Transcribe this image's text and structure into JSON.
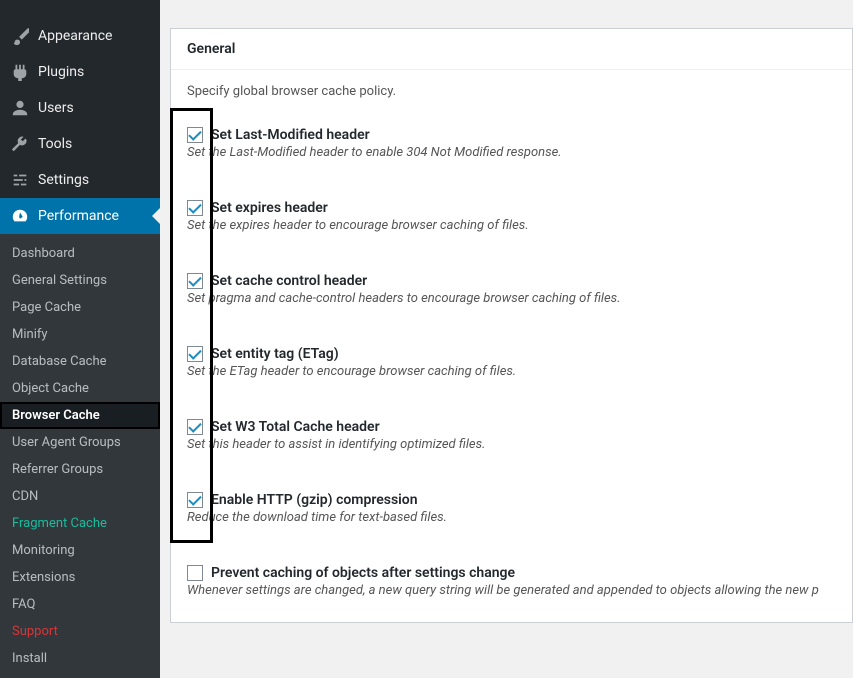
{
  "sidebar": {
    "main": [
      {
        "label": "Appearance",
        "icon": "brush"
      },
      {
        "label": "Plugins",
        "icon": "plug"
      },
      {
        "label": "Users",
        "icon": "user"
      },
      {
        "label": "Tools",
        "icon": "wrench"
      },
      {
        "label": "Settings",
        "icon": "sliders"
      },
      {
        "label": "Performance",
        "icon": "gauge",
        "active": true
      }
    ],
    "sub": [
      {
        "label": "Dashboard"
      },
      {
        "label": "General Settings"
      },
      {
        "label": "Page Cache"
      },
      {
        "label": "Minify"
      },
      {
        "label": "Database Cache"
      },
      {
        "label": "Object Cache"
      },
      {
        "label": "Browser Cache",
        "current": true
      },
      {
        "label": "User Agent Groups"
      },
      {
        "label": "Referrer Groups"
      },
      {
        "label": "CDN"
      },
      {
        "label": "Fragment Cache",
        "teal": true
      },
      {
        "label": "Monitoring"
      },
      {
        "label": "Extensions"
      },
      {
        "label": "FAQ"
      },
      {
        "label": "Support",
        "red": true
      },
      {
        "label": "Install"
      }
    ]
  },
  "panel": {
    "title": "General",
    "intro": "Specify global browser cache policy.",
    "options": [
      {
        "checked": true,
        "label": "Set Last-Modified header",
        "desc": "Set the Last-Modified header to enable 304 Not Modified response."
      },
      {
        "checked": true,
        "label": "Set expires header",
        "desc": "Set the expires header to encourage browser caching of files."
      },
      {
        "checked": true,
        "label": "Set cache control header",
        "desc": "Set pragma and cache-control headers to encourage browser caching of files."
      },
      {
        "checked": true,
        "label": "Set entity tag (ETag)",
        "desc": "Set the ETag header to encourage browser caching of files."
      },
      {
        "checked": true,
        "label": "Set W3 Total Cache header",
        "desc": "Set this header to assist in identifying optimized files."
      },
      {
        "checked": true,
        "label": "Enable HTTP (gzip) compression",
        "desc": "Reduce the download time for text-based files."
      },
      {
        "checked": false,
        "label": "Prevent caching of objects after settings change",
        "desc": "Whenever settings are changed, a new query string will be generated and appended to objects allowing the new p"
      }
    ]
  }
}
